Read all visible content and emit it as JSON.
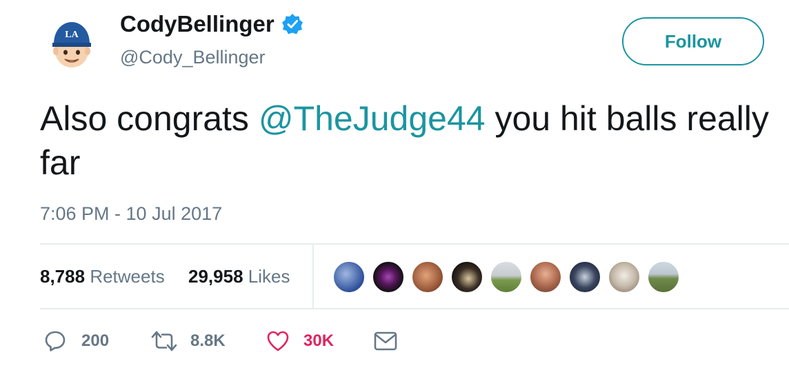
{
  "user": {
    "display_name": "CodyBellinger",
    "handle": "@Cody_Bellinger",
    "verified_icon": "verified-badge-icon",
    "avatar_icon": "dodgers-cap-emoji-avatar"
  },
  "follow_button": {
    "label": "Follow"
  },
  "tweet": {
    "text_before": "Also congrats ",
    "mention": "@TheJudge44",
    "text_after": " you hit balls really far",
    "timestamp": "7:06 PM - 10 Jul 2017"
  },
  "stats": {
    "retweets_count": "8,788",
    "retweets_label": "Retweets",
    "likes_count": "29,958",
    "likes_label": "Likes"
  },
  "liker_avatars": [
    {
      "name": "liker-avatar-1"
    },
    {
      "name": "liker-avatar-2"
    },
    {
      "name": "liker-avatar-3"
    },
    {
      "name": "liker-avatar-4"
    },
    {
      "name": "liker-avatar-5"
    },
    {
      "name": "liker-avatar-6"
    },
    {
      "name": "liker-avatar-7"
    },
    {
      "name": "liker-avatar-8"
    },
    {
      "name": "liker-avatar-9"
    }
  ],
  "actions": {
    "reply": {
      "icon": "reply-icon",
      "count": "200"
    },
    "retweet": {
      "icon": "retweet-icon",
      "count": "8.8K"
    },
    "like": {
      "icon": "heart-icon",
      "count": "30K"
    },
    "dm": {
      "icon": "envelope-icon"
    }
  },
  "colors": {
    "accent": "#1b95a0",
    "text": "#14171a",
    "muted": "#657786",
    "like": "#e0245e",
    "verified": "#1da1f2",
    "divider": "#e6ecf0"
  }
}
